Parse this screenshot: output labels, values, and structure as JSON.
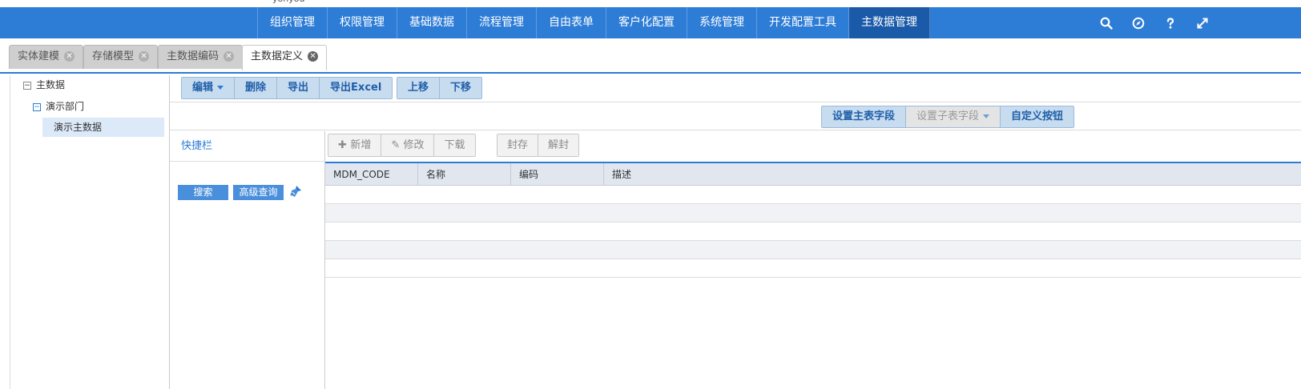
{
  "header": {
    "logo_text": "yonyou",
    "nav": [
      "组织管理",
      "权限管理",
      "基础数据",
      "流程管理",
      "自由表单",
      "客户化配置",
      "系统管理",
      "开发配置工具",
      "主数据管理"
    ],
    "active_nav": "主数据管理",
    "icons": [
      "search-icon",
      "compass-icon",
      "help-icon",
      "fullscreen-icon"
    ]
  },
  "tabs": [
    {
      "label": "实体建模",
      "active": false
    },
    {
      "label": "存储模型",
      "active": false
    },
    {
      "label": "主数据编码",
      "active": false
    },
    {
      "label": "主数据定义",
      "active": true
    }
  ],
  "tree": {
    "root": "主数据",
    "child": "演示部门",
    "leaf": "演示主数据"
  },
  "toolbar": {
    "edit": "编辑",
    "delete": "删除",
    "export": "导出",
    "export_excel": "导出Excel",
    "move_up": "上移",
    "move_down": "下移"
  },
  "field_toolbar": {
    "set_main": "设置主表字段",
    "set_sub": "设置子表字段",
    "custom_buttons": "自定义按钮"
  },
  "quick": {
    "title": "快捷栏",
    "search": "搜索",
    "advanced": "高级查询"
  },
  "grid_actions": {
    "add": "新增",
    "modify": "修改",
    "download": "下载",
    "seal": "封存",
    "unseal": "解封"
  },
  "grid": {
    "columns": [
      "MDM_CODE",
      "名称",
      "编码",
      "描述"
    ],
    "row_count": 5
  },
  "colors": {
    "primary": "#2d7cd6",
    "active_nav": "#1a5aa8",
    "button_bg": "#c8dcf0"
  }
}
